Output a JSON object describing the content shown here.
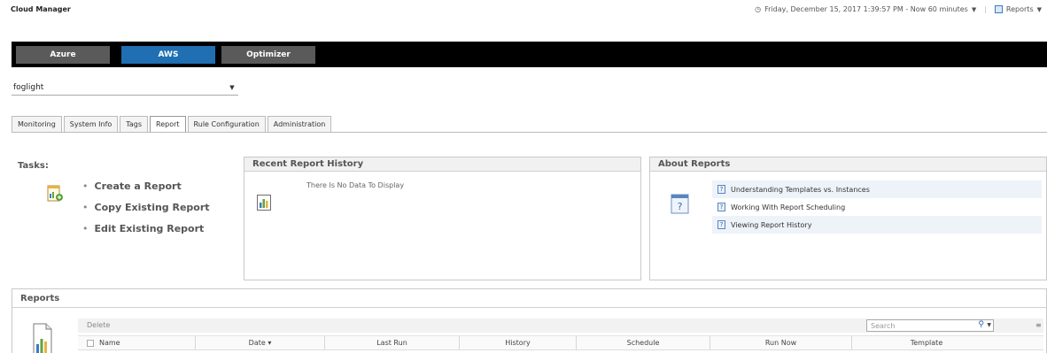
{
  "header": {
    "app_title": "Cloud Manager",
    "timestamp": "Friday, December 15, 2017 1:39:57 PM - Now 60 minutes",
    "reports_menu": "Reports"
  },
  "nav": {
    "tabs": [
      {
        "label": "Azure",
        "active": false
      },
      {
        "label": "AWS",
        "active": true
      },
      {
        "label": "Optimizer",
        "active": false
      }
    ]
  },
  "selector": {
    "value": "foglight"
  },
  "tabs": [
    {
      "label": "Monitoring",
      "active": false
    },
    {
      "label": "System Info",
      "active": false
    },
    {
      "label": "Tags",
      "active": false
    },
    {
      "label": "Report",
      "active": true
    },
    {
      "label": "Rule Configuration",
      "active": false
    },
    {
      "label": "Administration",
      "active": false
    }
  ],
  "tasks": {
    "title": "Tasks:",
    "items": [
      "Create a Report",
      "Copy Existing Report",
      "Edit Existing Report"
    ]
  },
  "recent_history": {
    "title": "Recent Report History",
    "empty_text": "There Is No Data To Display"
  },
  "about_reports": {
    "title": "About Reports",
    "links": [
      "Understanding Templates vs. Instances",
      "Working With Report Scheduling",
      "Viewing Report History"
    ]
  },
  "reports": {
    "title": "Reports",
    "delete_label": "Delete",
    "search_placeholder": "Search",
    "columns": [
      "Name",
      "Date ▾",
      "Last Run",
      "History",
      "Schedule",
      "Run Now",
      "Template"
    ]
  },
  "colors": {
    "nav_active": "#1f6fb2",
    "nav_inactive": "#5a5a5a",
    "nav_bar": "#000000"
  }
}
